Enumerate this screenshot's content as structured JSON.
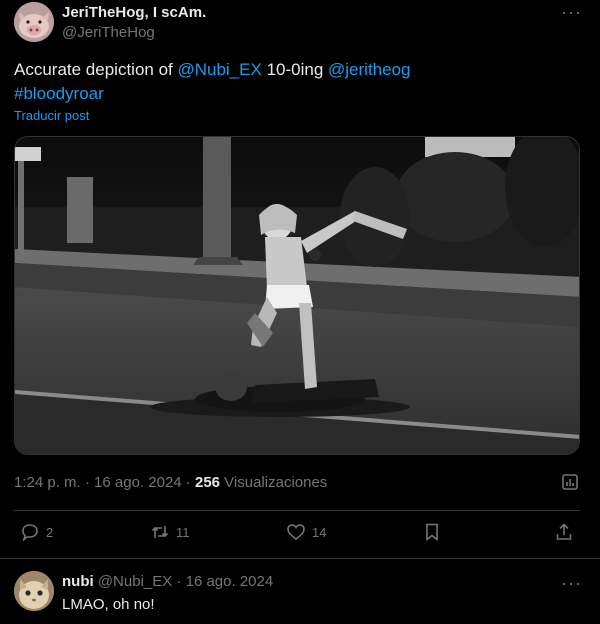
{
  "post": {
    "display_name": "JeriTheHog, I scAm.",
    "handle": "@JeriTheHog",
    "more": "···",
    "text_parts": {
      "p1": "Accurate depiction of ",
      "mention1": "@Nubi_EX",
      "p2": " 10-0ing ",
      "mention2": "@jeritheog",
      "hashtag": "#bloodyroar"
    },
    "translate": "Traducir post",
    "time": "1:24 p. m.",
    "sep": " · ",
    "date": "16 ago. 2024",
    "views": "256",
    "views_label": " Visualizaciones"
  },
  "actions": {
    "replies": "2",
    "reposts": "11",
    "likes": "14"
  },
  "icons": {
    "reply": "reply-icon",
    "repost": "repost-icon",
    "like": "heart-icon",
    "bookmark": "bookmark-icon",
    "share": "share-icon",
    "analytics": "analytics-icon",
    "more": "more-icon"
  },
  "reply": {
    "name": "nubi",
    "handle": "@Nubi_EX",
    "sep": " · ",
    "date": "16 ago. 2024",
    "text": "LMAO, oh no!",
    "more": "···"
  },
  "colors": {
    "accent": "#1d9bf0",
    "muted": "#71767b",
    "text": "#e7e9ea",
    "border": "#2f3336"
  }
}
